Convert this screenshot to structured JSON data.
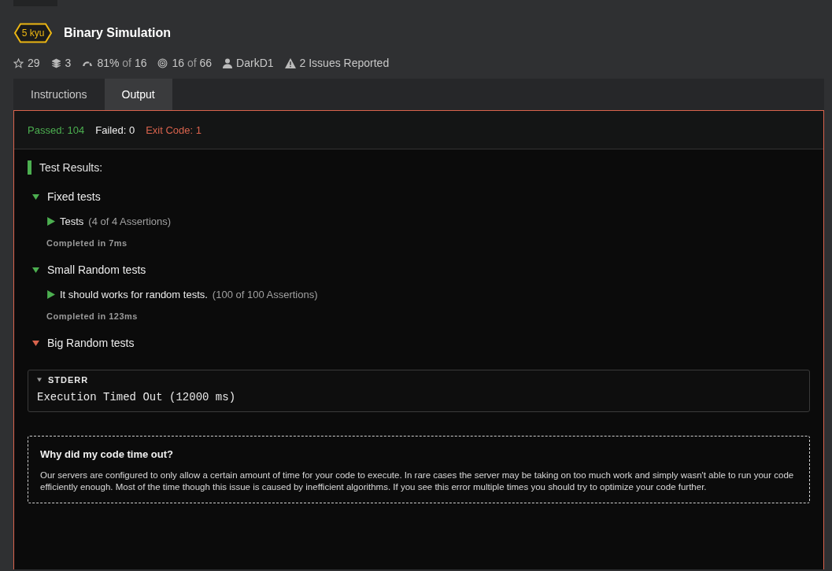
{
  "kata": {
    "rank": "5 kyu",
    "title": "Binary Simulation"
  },
  "stats": [
    {
      "kind": "stars",
      "value": "29"
    },
    {
      "kind": "collections",
      "value": "3"
    },
    {
      "kind": "satisfaction",
      "value": "81%",
      "of": "of",
      "total": "16"
    },
    {
      "kind": "completions",
      "value": "16",
      "of": "of",
      "total": "66"
    },
    {
      "kind": "author",
      "value": "DarkD1"
    },
    {
      "kind": "issues",
      "value": "2 Issues Reported"
    }
  ],
  "tabs": [
    {
      "label": "Instructions",
      "selected": false
    },
    {
      "label": "Output",
      "selected": true
    }
  ],
  "summary": {
    "passed": "Passed: 104",
    "failed": "Failed: 0",
    "exit_code": "Exit Code: 1"
  },
  "results_title": "Test Results:",
  "groups": [
    {
      "title": "Fixed tests",
      "passed": true,
      "expanded": true,
      "children": [
        {
          "title": "Tests",
          "assertions": "(4 of 4 Assertions)",
          "passed": true
        }
      ],
      "completed": "Completed in 7ms"
    },
    {
      "title": "Small Random tests",
      "passed": true,
      "expanded": true,
      "children": [
        {
          "title": "It should works for random tests.",
          "assertions": "(100 of 100 Assertions)",
          "passed": true
        }
      ],
      "completed": "Completed in 123ms"
    },
    {
      "title": "Big Random tests",
      "passed": false,
      "expanded": true
    }
  ],
  "stderr": {
    "label": "STDERR",
    "expanded": true,
    "text": "Execution Timed Out (12000 ms)"
  },
  "timeout_note": {
    "title": "Why did my code time out?",
    "body": "Our servers are configured to only allow a certain amount of time for your code to execute. In rare cases the server may be taking on too much work and simply wasn't able to run your code efficiently enough. Most of the time though this issue is caused by inefficient algorithms. If you see this error multiple times you should try to optimize your code further."
  }
}
